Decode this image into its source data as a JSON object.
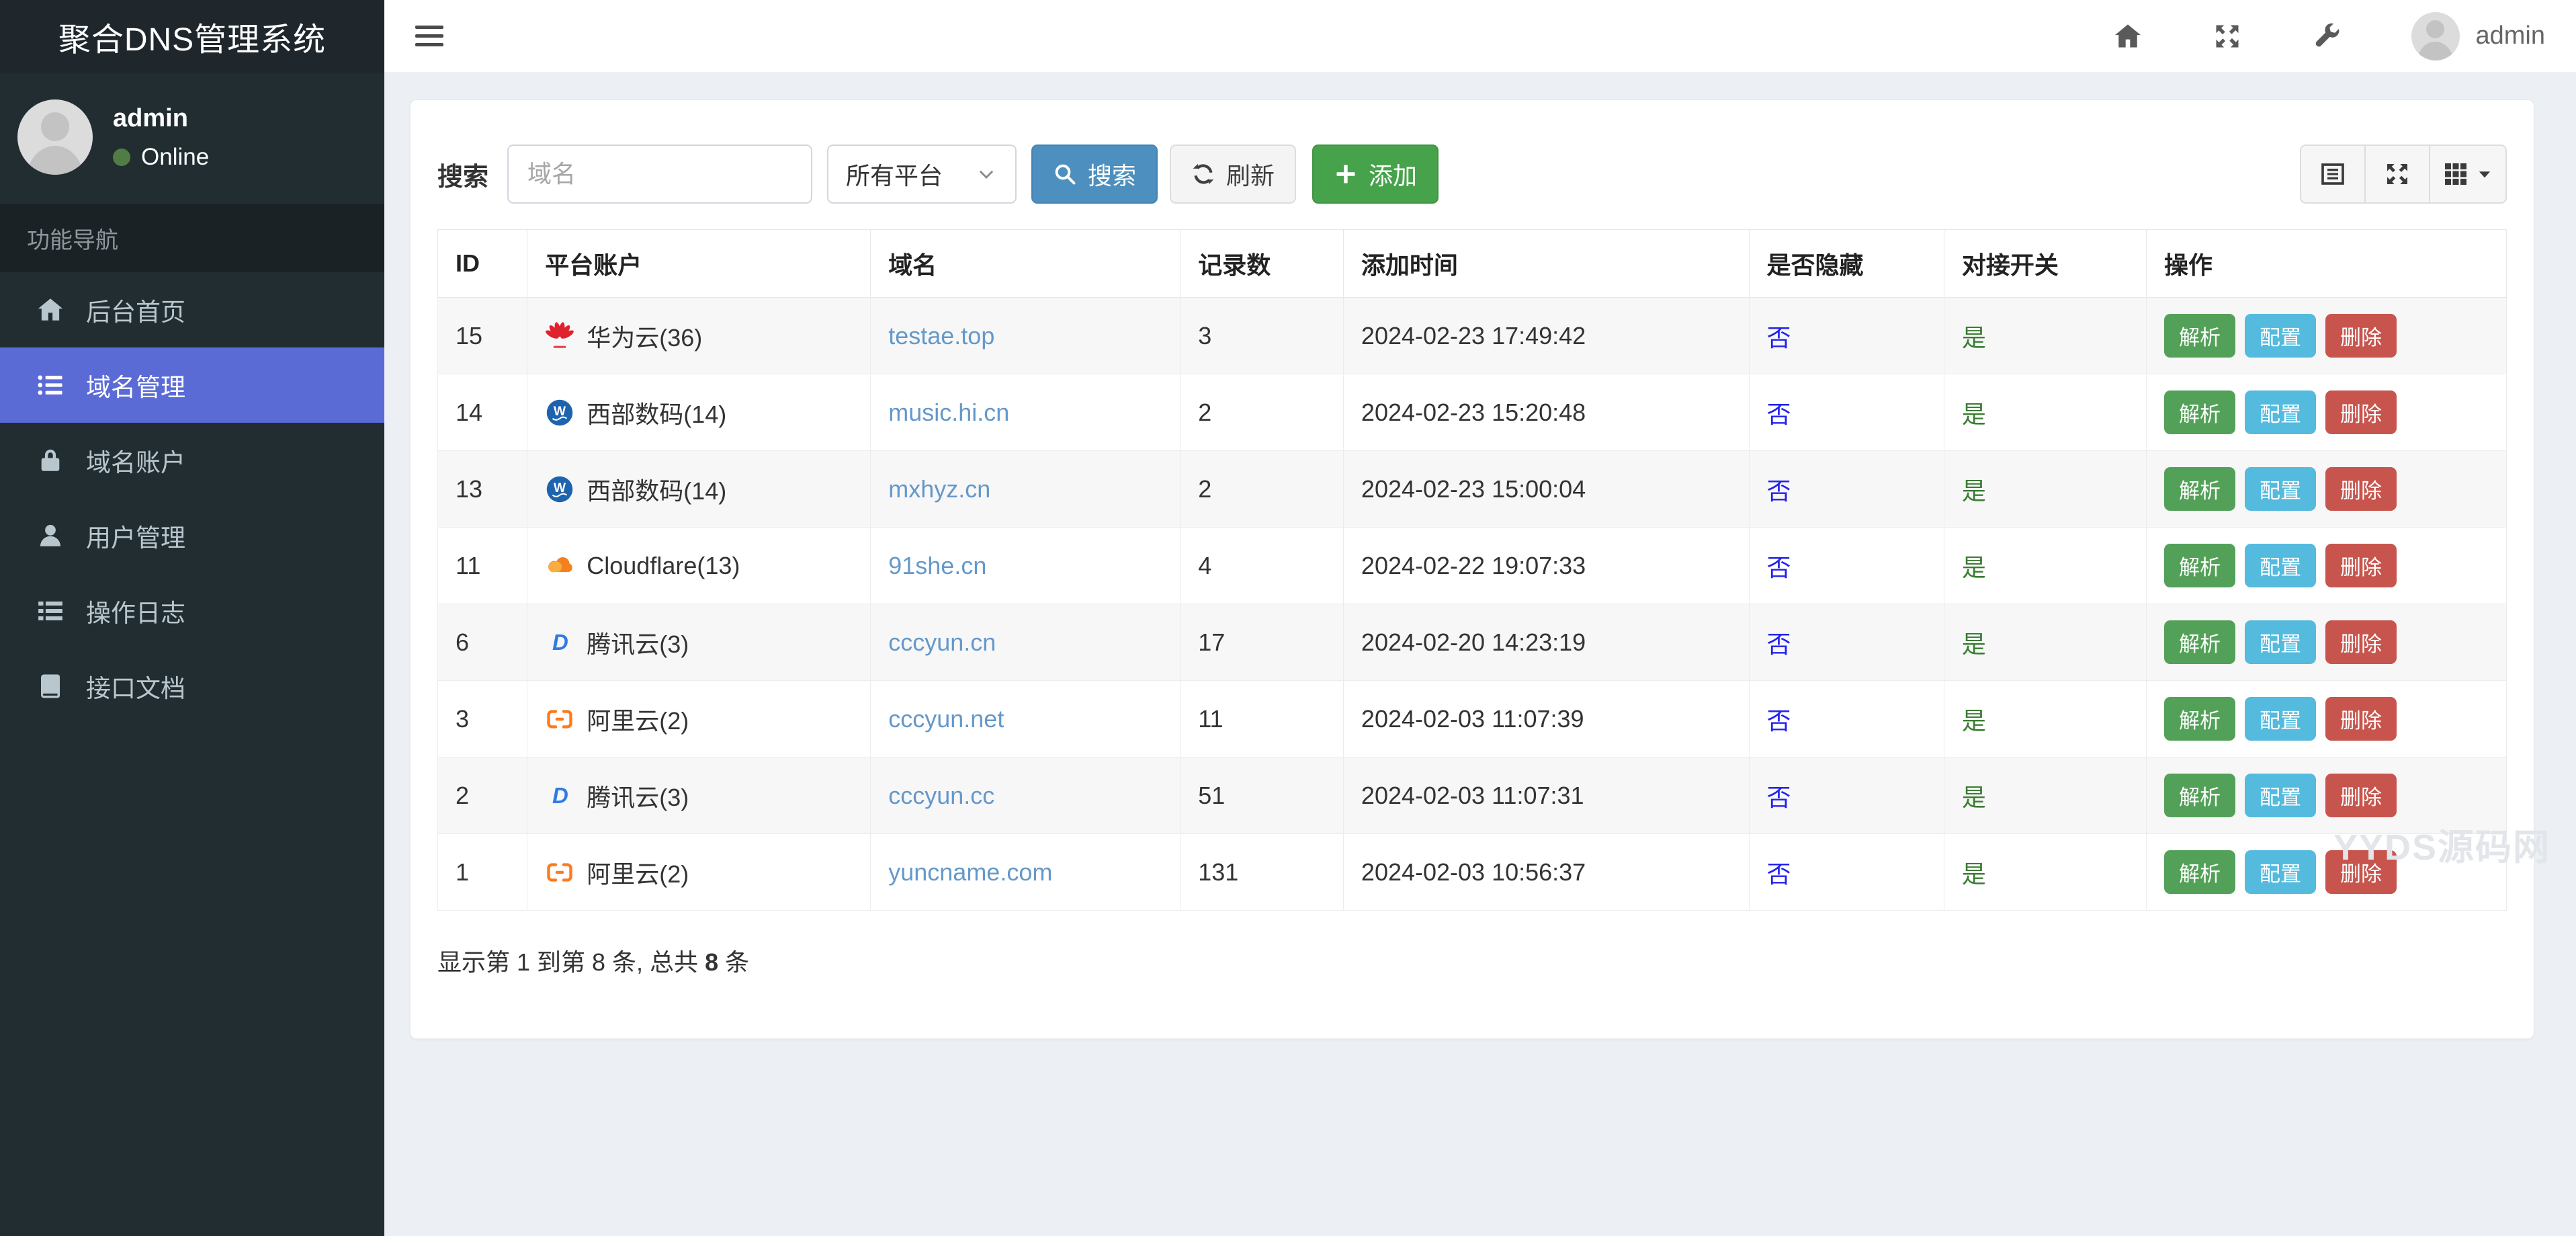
{
  "app": {
    "title": "聚合DNS管理系统"
  },
  "topbar": {
    "icons": [
      {
        "key": "home",
        "icon": "home"
      },
      {
        "key": "fullscreen",
        "icon": "arrows"
      },
      {
        "key": "tools",
        "icon": "wrench"
      }
    ],
    "user": "admin"
  },
  "sidebar": {
    "user": {
      "name": "admin",
      "status": "Online"
    },
    "section_label": "功能导航",
    "nav": [
      {
        "key": "dashboard",
        "icon": "home",
        "label": "后台首页",
        "active": false
      },
      {
        "key": "domain-management",
        "icon": "list",
        "label": "域名管理",
        "active": true
      },
      {
        "key": "domain-accounts",
        "icon": "lock",
        "label": "域名账户",
        "active": false
      },
      {
        "key": "user-management",
        "icon": "user",
        "label": "用户管理",
        "active": false
      },
      {
        "key": "operation-logs",
        "icon": "logs",
        "label": "操作日志",
        "active": false
      },
      {
        "key": "api-docs",
        "icon": "book",
        "label": "接口文档",
        "active": false
      }
    ]
  },
  "toolbar": {
    "search_label": "搜索",
    "search_placeholder": "域名",
    "platform_select_value": "所有平台",
    "search_button": "搜索",
    "refresh_button": "刷新",
    "add_button": "添加"
  },
  "view_toggle": [
    {
      "key": "toggle-columns-pane",
      "icons": [
        "listbox"
      ]
    },
    {
      "key": "fullscreen-table",
      "icons": [
        "arrows"
      ]
    },
    {
      "key": "columns-dropdown",
      "icons": [
        "grid",
        "caret"
      ]
    }
  ],
  "table": {
    "headers": [
      "ID",
      "平台账户",
      "域名",
      "记录数",
      "添加时间",
      "是否隐藏",
      "对接开关",
      "操作"
    ],
    "rows": [
      {
        "id": "15",
        "platform_icon": "huawei",
        "platform": "华为云(36)",
        "domain": "testae.top",
        "records": "3",
        "added": "2024-02-23 17:49:42",
        "hidden": "否",
        "switch": "是"
      },
      {
        "id": "14",
        "platform_icon": "west",
        "platform": "西部数码(14)",
        "domain": "music.hi.cn",
        "records": "2",
        "added": "2024-02-23 15:20:48",
        "hidden": "否",
        "switch": "是"
      },
      {
        "id": "13",
        "platform_icon": "west",
        "platform": "西部数码(14)",
        "domain": "mxhyz.cn",
        "records": "2",
        "added": "2024-02-23 15:00:04",
        "hidden": "否",
        "switch": "是"
      },
      {
        "id": "11",
        "platform_icon": "cloudflare",
        "platform": "Cloudflare(13)",
        "domain": "91she.cn",
        "records": "4",
        "added": "2024-02-22 19:07:33",
        "hidden": "否",
        "switch": "是"
      },
      {
        "id": "6",
        "platform_icon": "dnspod",
        "platform": "腾讯云(3)",
        "domain": "cccyun.cn",
        "records": "17",
        "added": "2024-02-20 14:23:19",
        "hidden": "否",
        "switch": "是"
      },
      {
        "id": "3",
        "platform_icon": "aliyun",
        "platform": "阿里云(2)",
        "domain": "cccyun.net",
        "records": "11",
        "added": "2024-02-03 11:07:39",
        "hidden": "否",
        "switch": "是"
      },
      {
        "id": "2",
        "platform_icon": "dnspod",
        "platform": "腾讯云(3)",
        "domain": "cccyun.cc",
        "records": "51",
        "added": "2024-02-03 11:07:31",
        "hidden": "否",
        "switch": "是"
      },
      {
        "id": "1",
        "platform_icon": "aliyun",
        "platform": "阿里云(2)",
        "domain": "yuncname.com",
        "records": "131",
        "added": "2024-02-03 10:56:37",
        "hidden": "否",
        "switch": "是"
      }
    ],
    "actions": [
      {
        "label": "解析",
        "type": "success"
      },
      {
        "label": "配置",
        "type": "info"
      },
      {
        "label": "删除",
        "type": "danger"
      }
    ]
  },
  "footer": {
    "prefix": "显示第 1 到第 8 条, 总共 ",
    "total": "8",
    "suffix": " 条"
  },
  "watermark": "YYDS源码网",
  "colors": {
    "accent": "#5b6bd5",
    "link": "#6598c9",
    "hidden_no": "#2222ee",
    "switch_yes": "#3a7d32",
    "btn_primary": "#4d8fbe",
    "btn_success": "#47a34b",
    "action_success": "#53a158",
    "action_info": "#54bade",
    "action_danger": "#c7554d"
  }
}
